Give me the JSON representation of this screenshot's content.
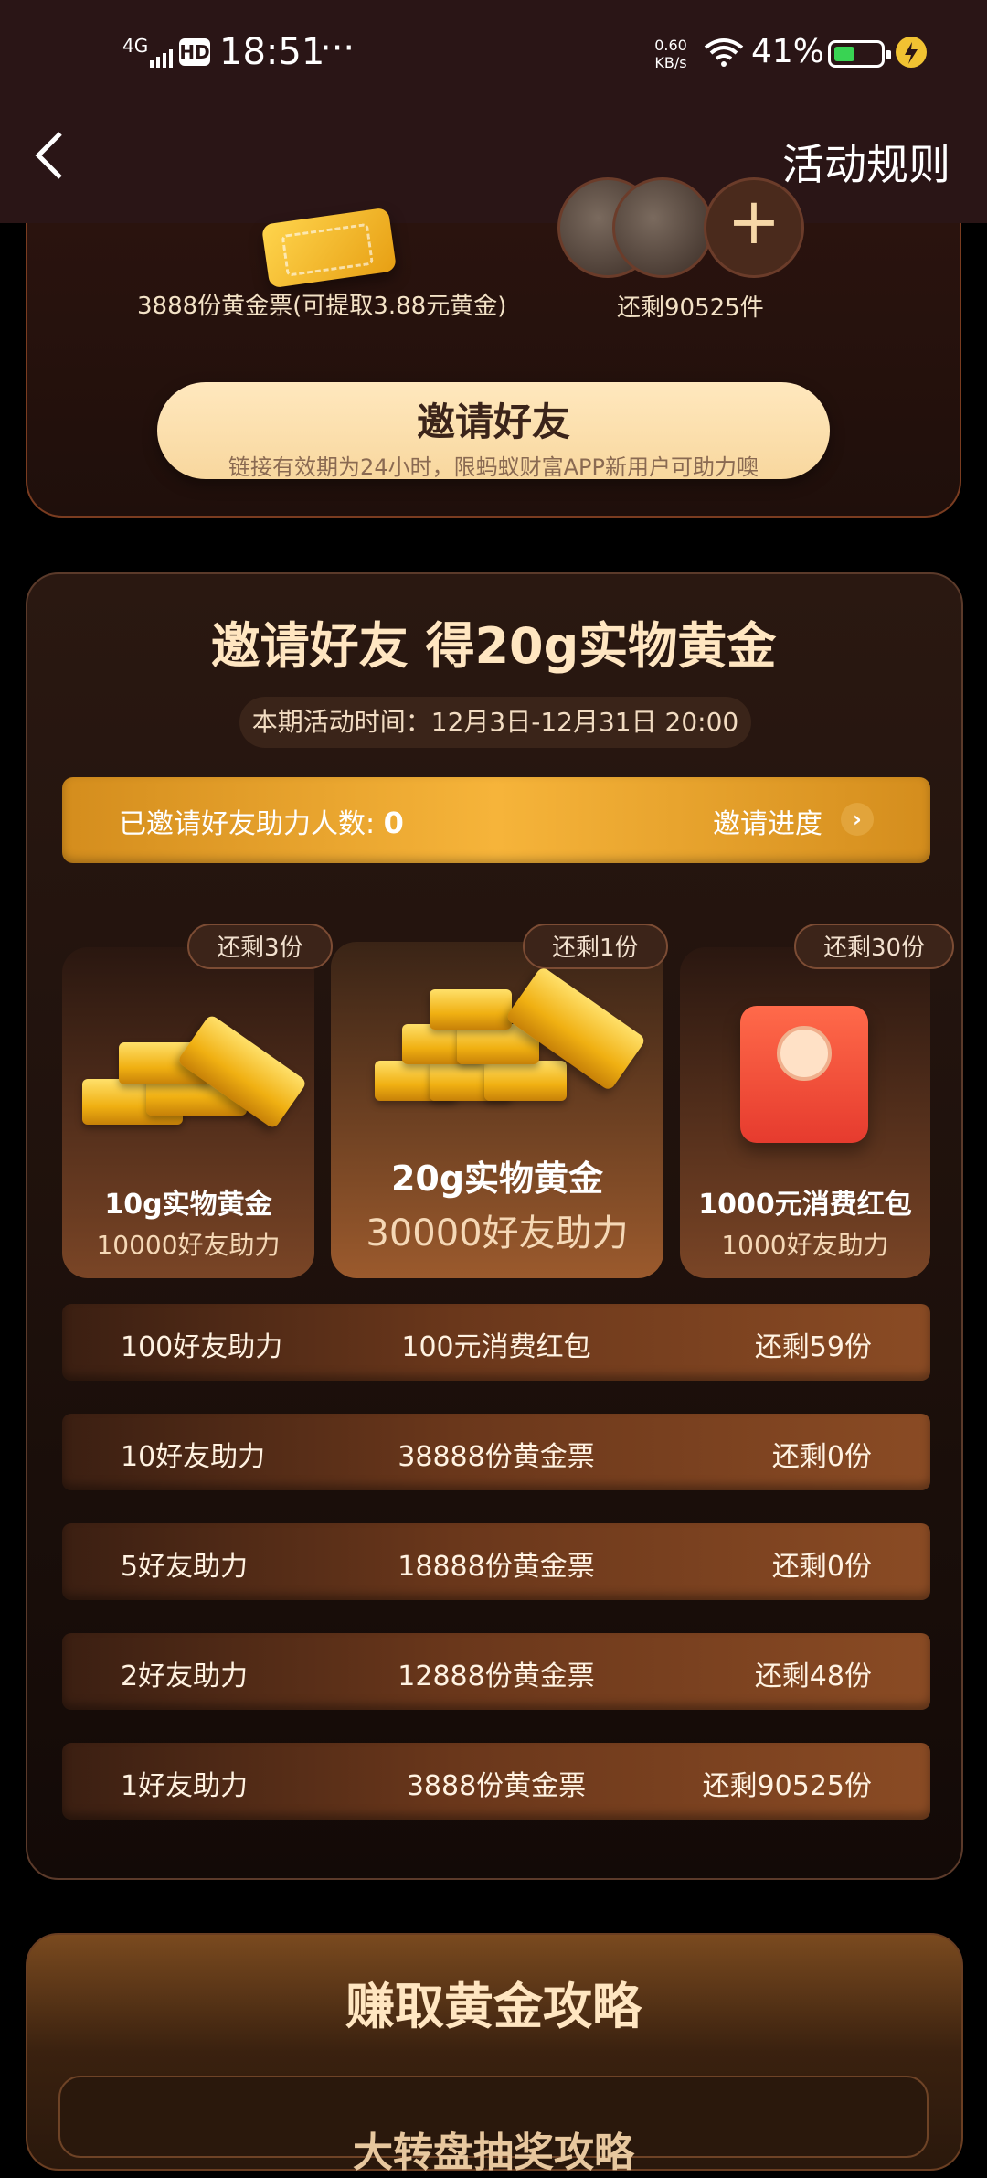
{
  "status_bar": {
    "network": "4G",
    "hd": "HD",
    "time": "18:51",
    "dots": "···",
    "speed_top": "0.60",
    "speed_bottom": "KB/s",
    "battery_pct": "41%"
  },
  "nav": {
    "back_icon": "chevron-left-icon",
    "rules_label": "活动规则"
  },
  "top_card": {
    "left_caption": "3888份黄金票(可提取3.88元黄金)",
    "right_caption": "还剩90525件",
    "avatar_plus": "+",
    "invite_button": {
      "title": "邀请好友",
      "subtitle": "链接有效期为24小时，限蚂蚁财富APP新用户可助力噢"
    }
  },
  "main_card": {
    "title": "邀请好友 得20g实物黄金",
    "period": "本期活动时间：12月3日-12月31日 20:00",
    "progress": {
      "label": "已邀请好友助力人数:",
      "count": "0",
      "link": "邀请进度",
      "arrow": "›"
    },
    "prizes": [
      {
        "tag": "还剩3份",
        "title": "10g实物黄金",
        "sub": "10000好友助力",
        "icon": "gold-bars-icon"
      },
      {
        "tag": "还剩1份",
        "title": "20g实物黄金",
        "sub": "30000好友助力",
        "icon": "gold-bars-stack-icon"
      },
      {
        "tag": "还剩30份",
        "title": "1000元消费红包",
        "sub": "1000好友助力",
        "icon": "red-envelope-icon"
      }
    ],
    "rows": [
      {
        "friends": "100好友助力",
        "reward": "100元消费红包",
        "left": "还剩59份"
      },
      {
        "friends": "10好友助力",
        "reward": "38888份黄金票",
        "left": "还剩0份"
      },
      {
        "friends": "5好友助力",
        "reward": "18888份黄金票",
        "left": "还剩0份"
      },
      {
        "friends": "2好友助力",
        "reward": "12888份黄金票",
        "left": "还剩48份"
      },
      {
        "friends": "1好友助力",
        "reward": "3888份黄金票",
        "left": "还剩90525份"
      }
    ]
  },
  "bottom_card": {
    "title": "赚取黄金攻略",
    "sub": "大转盘抽奖攻略"
  },
  "colors": {
    "accent": "#f6b43a",
    "background": "#000000",
    "header": "#2a1516"
  }
}
